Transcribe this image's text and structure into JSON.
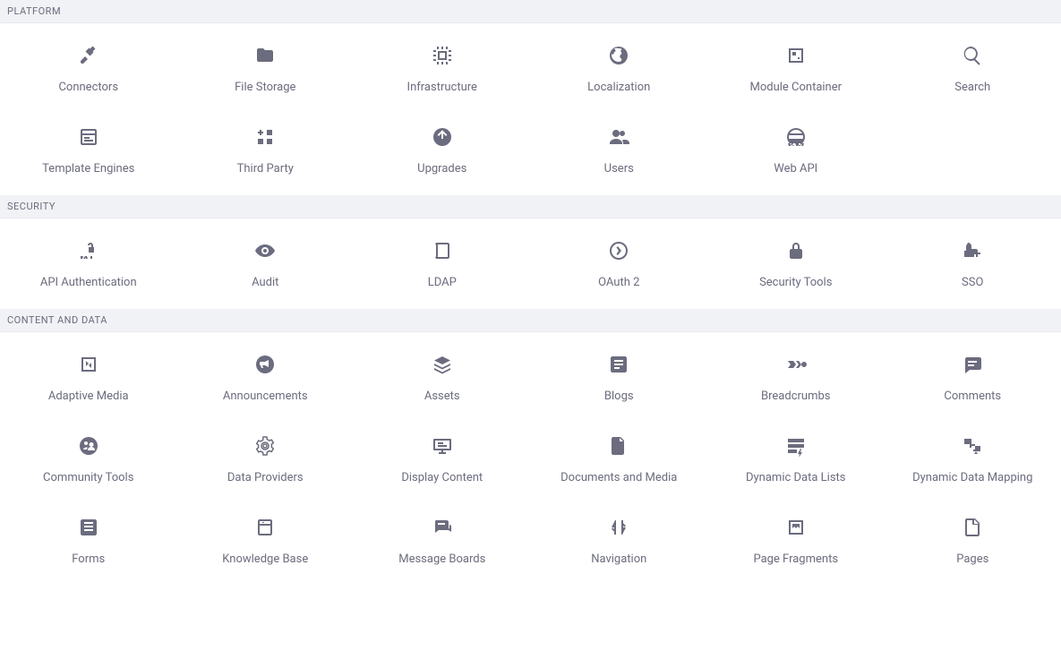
{
  "sections": [
    {
      "title": "PLATFORM",
      "items": [
        {
          "label": "Connectors",
          "icon": "plug-icon"
        },
        {
          "label": "File Storage",
          "icon": "folder-icon"
        },
        {
          "label": "Infrastructure",
          "icon": "cpu-icon"
        },
        {
          "label": "Localization",
          "icon": "globe-icon"
        },
        {
          "label": "Module Container",
          "icon": "module-icon"
        },
        {
          "label": "Search",
          "icon": "search-icon"
        },
        {
          "label": "Template Engines",
          "icon": "template-icon"
        },
        {
          "label": "Third Party",
          "icon": "grid-add-icon"
        },
        {
          "label": "Upgrades",
          "icon": "upload-circle-icon"
        },
        {
          "label": "Users",
          "icon": "users-icon"
        },
        {
          "label": "Web API",
          "icon": "web-api-icon"
        }
      ]
    },
    {
      "title": "SECURITY",
      "items": [
        {
          "label": "API Authentication",
          "icon": "api-lock-icon"
        },
        {
          "label": "Audit",
          "icon": "eye-icon"
        },
        {
          "label": "LDAP",
          "icon": "book-icon"
        },
        {
          "label": "OAuth 2",
          "icon": "oauth-icon"
        },
        {
          "label": "Security Tools",
          "icon": "lock-icon"
        },
        {
          "label": "SSO",
          "icon": "sso-icon"
        }
      ]
    },
    {
      "title": "CONTENT AND DATA",
      "items": [
        {
          "label": "Adaptive Media",
          "icon": "adaptive-icon"
        },
        {
          "label": "Announcements",
          "icon": "bullhorn-icon"
        },
        {
          "label": "Assets",
          "icon": "layers-icon"
        },
        {
          "label": "Blogs",
          "icon": "blogs-icon"
        },
        {
          "label": "Breadcrumbs",
          "icon": "breadcrumbs-icon"
        },
        {
          "label": "Comments",
          "icon": "comment-icon"
        },
        {
          "label": "Community Tools",
          "icon": "community-icon"
        },
        {
          "label": "Data Providers",
          "icon": "gear-icon"
        },
        {
          "label": "Display Content",
          "icon": "display-icon"
        },
        {
          "label": "Documents and Media",
          "icon": "documents-icon"
        },
        {
          "label": "Dynamic Data Lists",
          "icon": "grid-bolt-icon"
        },
        {
          "label": "Dynamic Data Mapping",
          "icon": "mapping-icon"
        },
        {
          "label": "Forms",
          "icon": "form-icon"
        },
        {
          "label": "Knowledge Base",
          "icon": "kb-icon"
        },
        {
          "label": "Message Boards",
          "icon": "message-board-icon"
        },
        {
          "label": "Navigation",
          "icon": "navigation-icon"
        },
        {
          "label": "Page Fragments",
          "icon": "fragments-icon"
        },
        {
          "label": "Pages",
          "icon": "page-icon"
        }
      ]
    }
  ]
}
